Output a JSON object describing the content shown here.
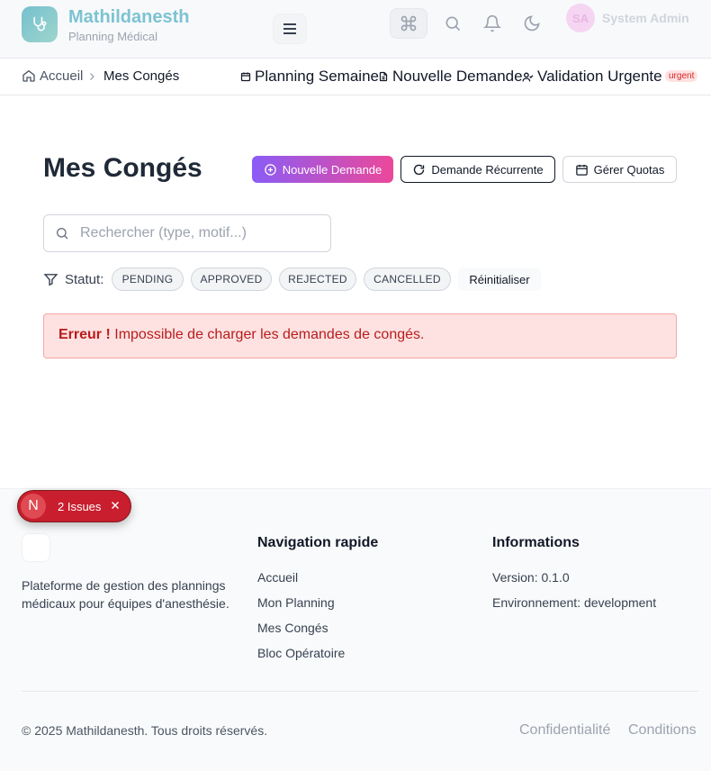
{
  "header": {
    "brand_name": "Mathildanesth",
    "brand_sub": "Planning Médical",
    "avatar_initials": "SA",
    "user_name": "System Admin"
  },
  "breadcrumb": {
    "home": "Accueil",
    "current": "Mes Congés"
  },
  "quick_links": {
    "planning": "Planning Semaine",
    "new_request": "Nouvelle Demande",
    "validation": "Validation Urgente",
    "urgent_badge": "urgent"
  },
  "main": {
    "title": "Mes Congés",
    "btn_new": "Nouvelle Demande",
    "btn_recurring": "Demande Récurrente",
    "btn_quotas": "Gérer Quotas",
    "search_placeholder": "Rechercher (type, motif...)",
    "filter_label": "Statut:",
    "chips": [
      "PENDING",
      "APPROVED",
      "REJECTED",
      "CANCELLED"
    ],
    "reset": "Réinitialiser",
    "alert_strong": "Erreur !",
    "alert_text": "Impossible de charger les demandes de congés."
  },
  "footer": {
    "description": "Plateforme de gestion des plannings médicaux pour équipes d'anesthésie.",
    "nav_title": "Navigation rapide",
    "nav_links": [
      "Accueil",
      "Mon Planning",
      "Mes Congés",
      "Bloc Opératoire"
    ],
    "info_title": "Informations",
    "version": "Version: 0.1.0",
    "environment": "Environnement: development",
    "copyright": "© 2025 Mathildanesth. Tous droits réservés.",
    "privacy": "Confidentialité",
    "terms": "Conditions"
  },
  "issues_badge": {
    "letter": "N",
    "label": "2 Issues"
  },
  "colors": {
    "accent_gradient_start": "#8b5cf6",
    "accent_gradient_end": "#ec4899",
    "error_bg": "#fee2e2",
    "error_text": "#b91c1c",
    "issues_red": "#c81e2e"
  }
}
